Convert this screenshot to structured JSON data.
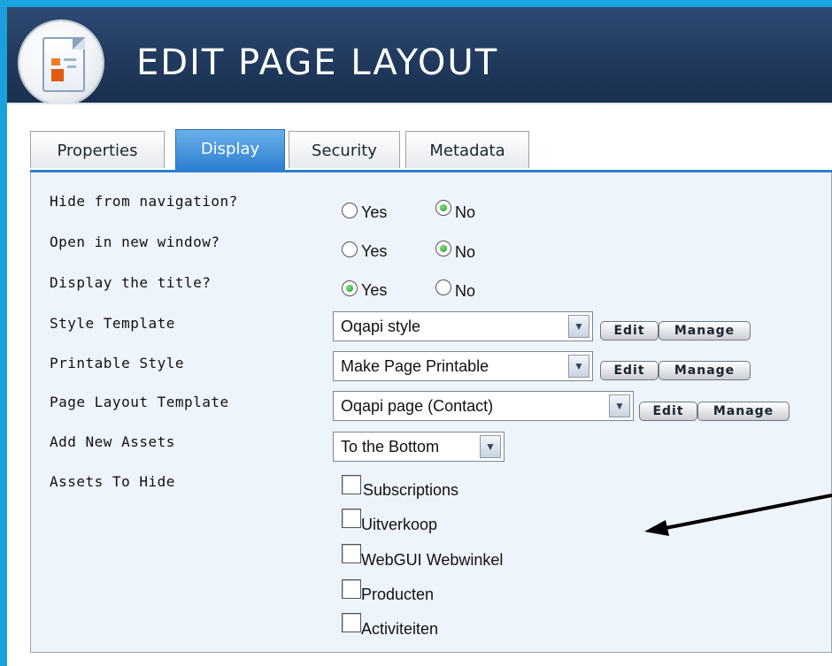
{
  "header": {
    "title": "EDIT PAGE LAYOUT",
    "icon": "page-layout-icon"
  },
  "tabs": [
    {
      "label": "Properties",
      "active": false
    },
    {
      "label": "Display",
      "active": true
    },
    {
      "label": "Security",
      "active": false
    },
    {
      "label": "Metadata",
      "active": false
    }
  ],
  "fields": {
    "hide_from_navigation": {
      "label": "Hide from navigation?",
      "yes": "Yes",
      "no": "No",
      "value": "No"
    },
    "open_in_new_window": {
      "label": "Open in new window?",
      "yes": "Yes",
      "no": "No",
      "value": "No"
    },
    "display_title": {
      "label": "Display the title?",
      "yes": "Yes",
      "no": "No",
      "value": "Yes"
    },
    "style_template": {
      "label": "Style Template",
      "value": "Oqapi style",
      "edit": "Edit",
      "manage": "Manage"
    },
    "printable_style": {
      "label": "Printable Style",
      "value": "Make Page Printable",
      "edit": "Edit",
      "manage": "Manage"
    },
    "page_layout_template": {
      "label": "Page Layout Template",
      "value": "Oqapi page (Contact)",
      "edit": "Edit",
      "manage": "Manage"
    },
    "add_new_assets": {
      "label": "Add New Assets",
      "value": "To the Bottom"
    },
    "assets_to_hide": {
      "label": "Assets To Hide",
      "options": [
        {
          "label": "Subscriptions",
          "checked": false
        },
        {
          "label": "Uitverkoop",
          "checked": false
        },
        {
          "label": "WebGUI Webwinkel",
          "checked": false
        },
        {
          "label": "Producten",
          "checked": false
        },
        {
          "label": "Activiteiten",
          "checked": false
        }
      ]
    }
  },
  "colors": {
    "frame": "#1aa0dc",
    "header": "#213a5e",
    "active_tab": "#2e7ed1",
    "content_bg": "#eef4fb",
    "annotation_arrow": "#000000"
  }
}
